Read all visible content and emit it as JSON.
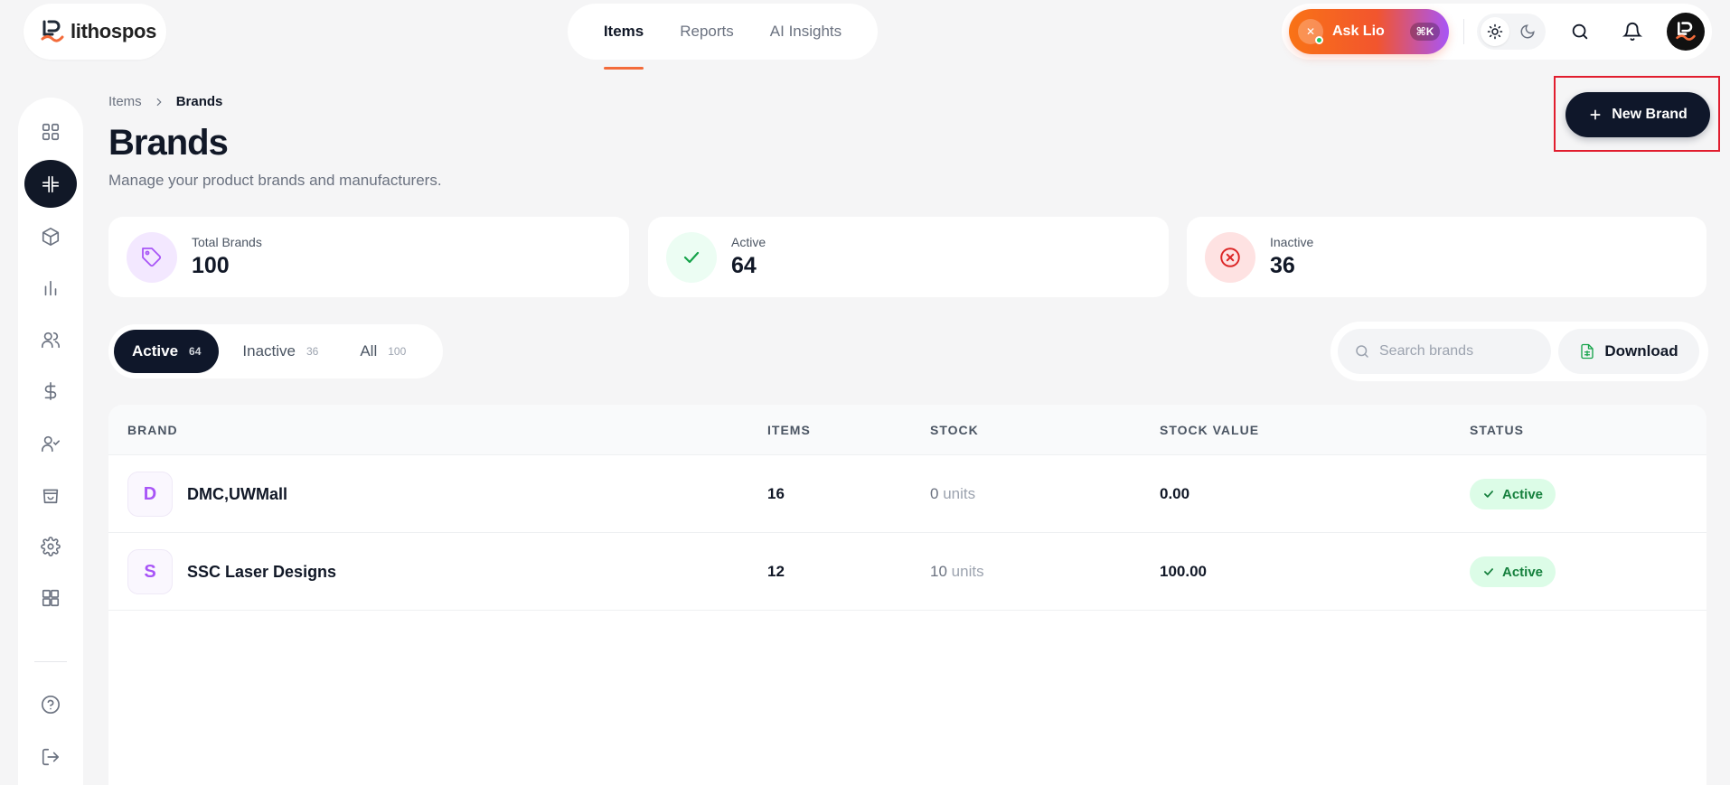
{
  "app": {
    "logo_text": "lithospos"
  },
  "top_nav": {
    "tabs": [
      {
        "label": "Items"
      },
      {
        "label": "Reports"
      },
      {
        "label": "AI Insights"
      }
    ]
  },
  "assistant": {
    "label": "Ask Lio",
    "shortcut": "⌘K"
  },
  "breadcrumb": {
    "parent": "Items",
    "current": "Brands"
  },
  "page": {
    "title": "Brands",
    "subtitle": "Manage your product brands and manufacturers."
  },
  "actions": {
    "new_brand": "New Brand",
    "download": "Download"
  },
  "stats": [
    {
      "label": "Total Brands",
      "value": "100"
    },
    {
      "label": "Active",
      "value": "64"
    },
    {
      "label": "Inactive",
      "value": "36"
    }
  ],
  "filter_tabs": [
    {
      "label": "Active",
      "count": "64"
    },
    {
      "label": "Inactive",
      "count": "36"
    },
    {
      "label": "All",
      "count": "100"
    }
  ],
  "search": {
    "placeholder": "Search brands"
  },
  "table": {
    "headers": [
      "BRAND",
      "ITEMS",
      "STOCK",
      "STOCK VALUE",
      "STATUS"
    ],
    "rows": [
      {
        "initial": "D",
        "brand": "DMC,UWMall",
        "items": "16",
        "stock": "0",
        "stock_unit": "units",
        "stock_value": "0.00",
        "status": "Active"
      },
      {
        "initial": "S",
        "brand": "SSC Laser Designs",
        "items": "12",
        "stock": "10",
        "stock_unit": "units",
        "stock_value": "100.00",
        "status": "Active"
      }
    ]
  },
  "colors": {
    "accent": "#f36b3a",
    "primary_dark": "#0f172a",
    "active_green": "#15803d",
    "brand_purple": "#a855f7"
  }
}
